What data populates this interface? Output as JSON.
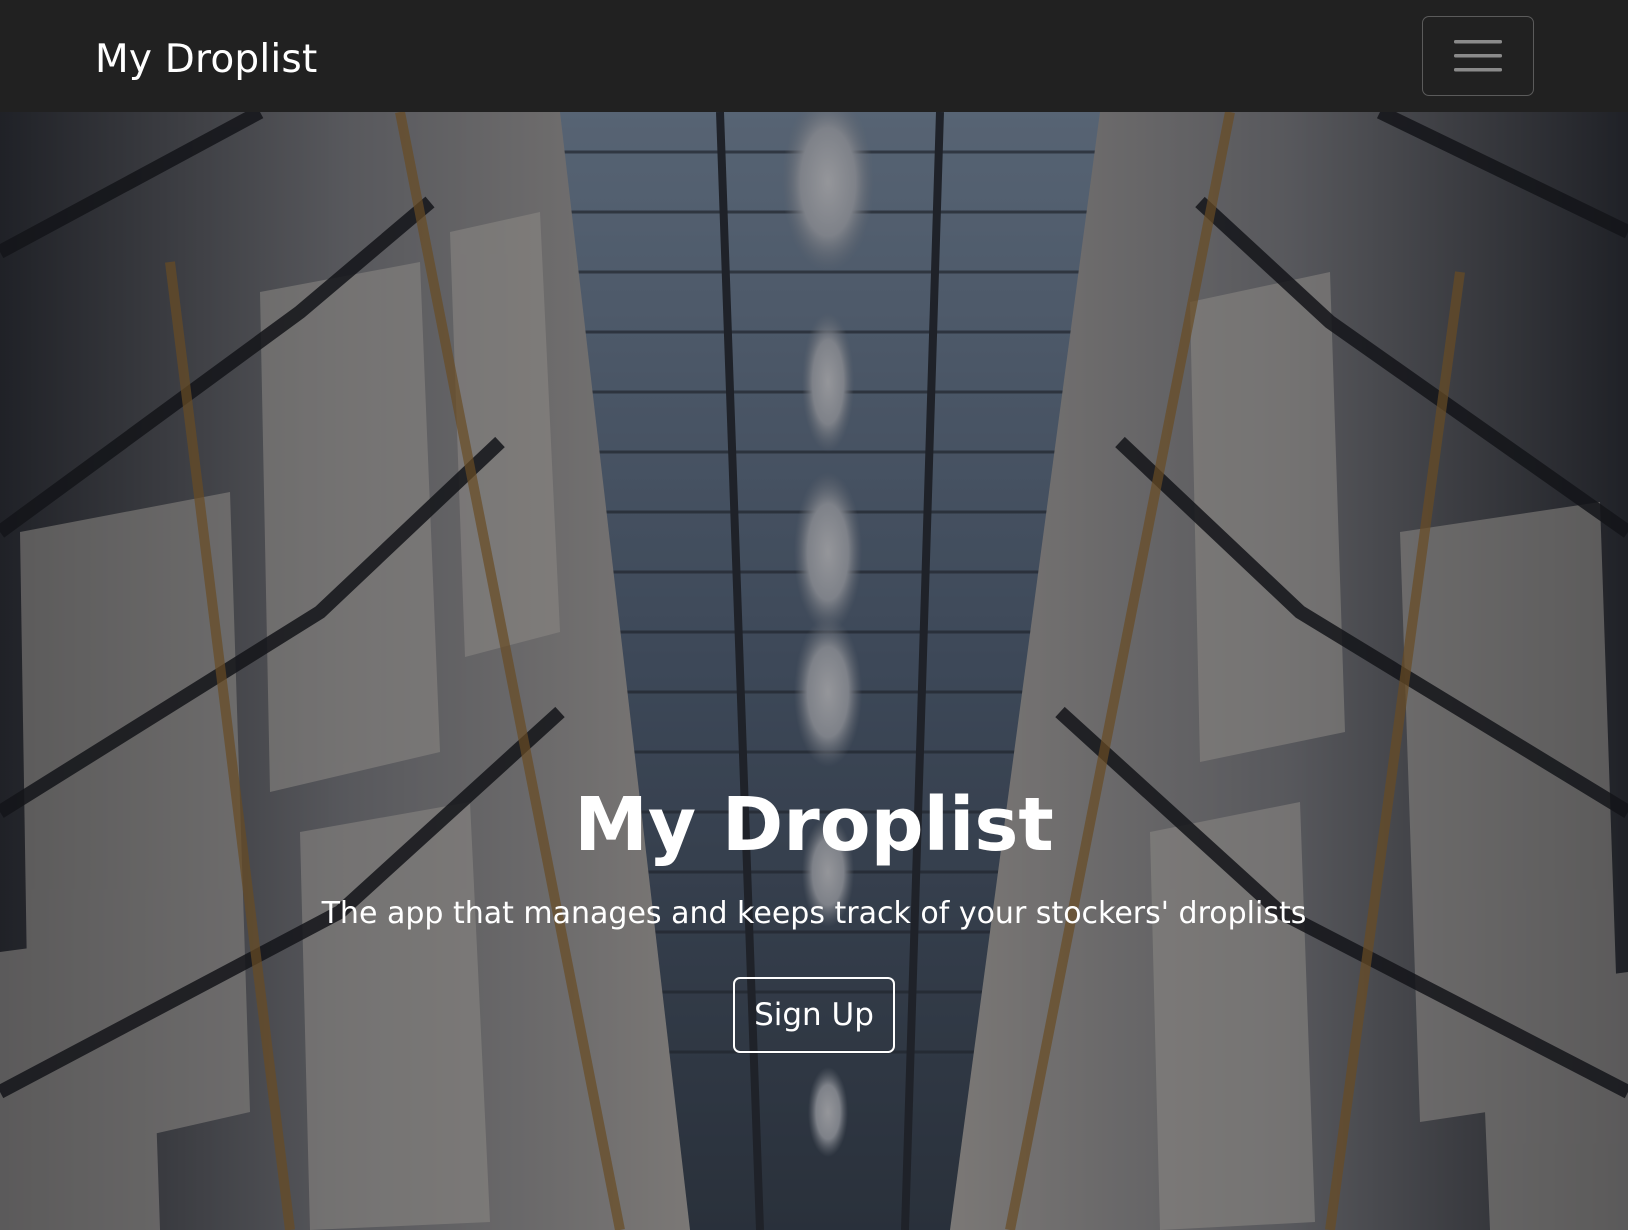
{
  "navbar": {
    "brand": "My Droplist",
    "toggler_icon": "hamburger-menu-icon"
  },
  "hero": {
    "background": "warehouse-aisle-photo",
    "title": "My Droplist",
    "subtitle": "The app that manages and keeps track of your stockers' droplists",
    "cta_label": "Sign Up"
  },
  "colors": {
    "navbar_bg": "#212121",
    "text": "#ffffff",
    "toggler_border": "#5b5b5b"
  }
}
